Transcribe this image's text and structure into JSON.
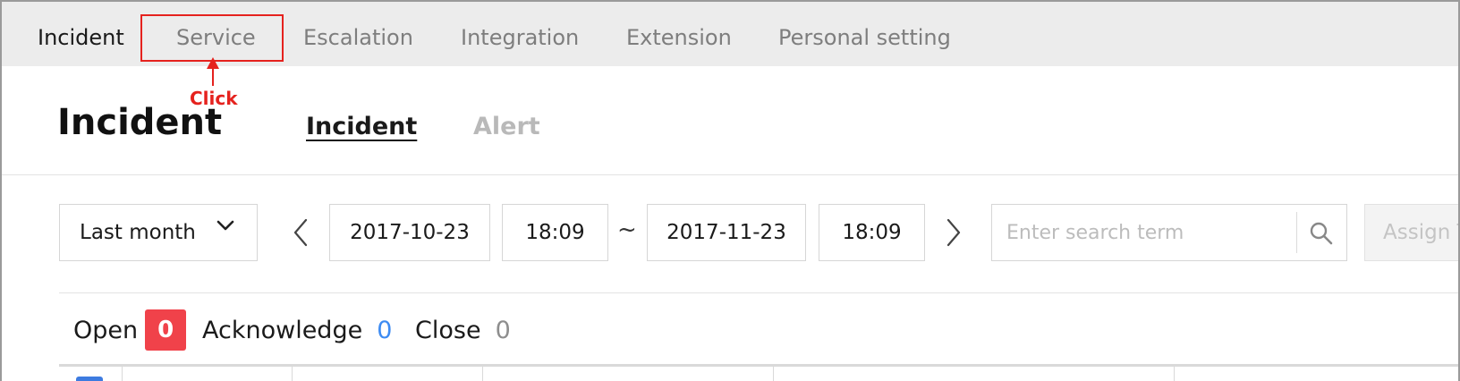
{
  "top_nav": {
    "tabs": [
      {
        "label": "Incident",
        "active": true
      },
      {
        "label": "Service",
        "active": false
      },
      {
        "label": "Escalation",
        "active": false
      },
      {
        "label": "Integration",
        "active": false
      },
      {
        "label": "Extension",
        "active": false
      },
      {
        "label": "Personal setting",
        "active": false
      }
    ]
  },
  "annotation": {
    "label": "Click",
    "color": "#e5221e"
  },
  "page": {
    "title": "Incident",
    "subtabs": [
      {
        "label": "Incident",
        "active": true
      },
      {
        "label": "Alert",
        "active": false
      }
    ]
  },
  "filters": {
    "range_select": "Last month",
    "start_date": "2017-10-23",
    "start_time": "18:09",
    "separator": "~",
    "end_date": "2017-11-23",
    "end_time": "18:09",
    "search_placeholder": "Enter search term",
    "assign_label": "Assign T"
  },
  "status": {
    "open_label": "Open",
    "open_count": "0",
    "acknowledge_label": "Acknowledge",
    "acknowledge_count": "0",
    "close_label": "Close",
    "close_count": "0"
  },
  "colors": {
    "nav_bg": "#ececec",
    "annotation_red": "#e5221e",
    "open_badge": "#f0424a",
    "acknowledge_blue": "#3d8bf2",
    "close_gray": "#8e8e8e"
  }
}
